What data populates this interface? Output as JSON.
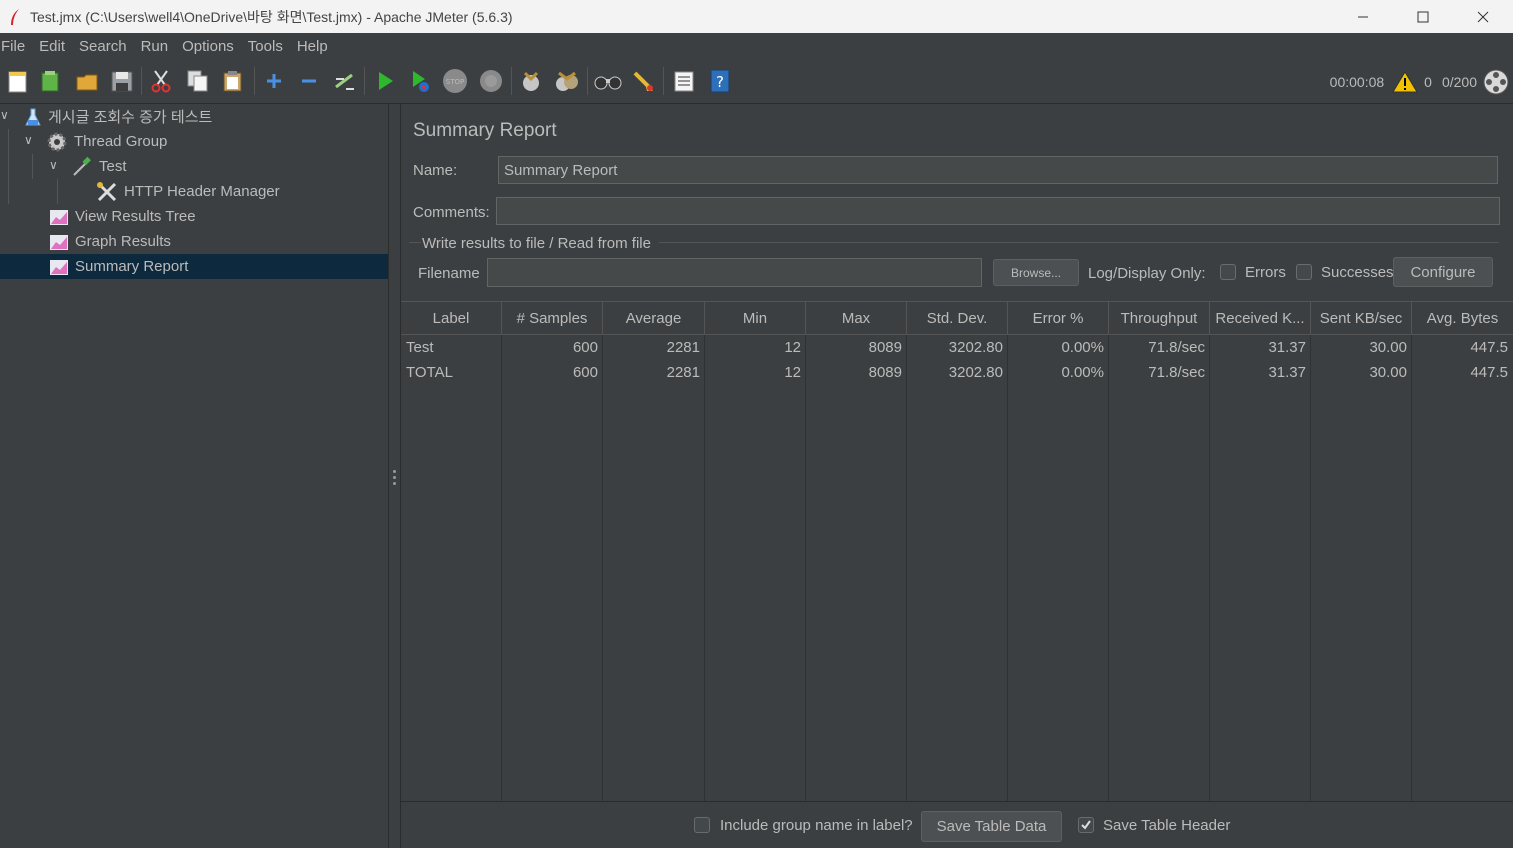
{
  "window": {
    "title": "Test.jmx (C:\\Users\\well4\\OneDrive\\바탕 화면\\Test.jmx) - Apache JMeter (5.6.3)"
  },
  "menu": [
    "File",
    "Edit",
    "Search",
    "Run",
    "Options",
    "Tools",
    "Help"
  ],
  "toolbar": {
    "icons": [
      "new-icon",
      "templates-icon",
      "open-icon",
      "save-icon",
      "cut-icon",
      "copy-icon",
      "paste-icon",
      "expand-icon",
      "collapse-icon",
      "toggle-icon",
      "start-icon",
      "start-no-pause-icon",
      "stop-icon",
      "shutdown-icon",
      "clear-icon",
      "clear-all-icon",
      "search-icon",
      "reset-search-icon",
      "function-helper-icon",
      "help-icon"
    ]
  },
  "status": {
    "elapsed": "00:00:08",
    "warnings": "0",
    "threads": "0/200"
  },
  "tree": {
    "nodes": [
      {
        "label": "게시글 조회수 증가 테스트",
        "icon": "test-plan-icon"
      },
      {
        "label": "Thread Group",
        "icon": "gear-icon"
      },
      {
        "label": "Test",
        "icon": "sampler-icon"
      },
      {
        "label": "HTTP Header Manager",
        "icon": "tools-icon"
      },
      {
        "label": "View Results Tree",
        "icon": "listener-icon"
      },
      {
        "label": "Graph Results",
        "icon": "listener-icon"
      },
      {
        "label": "Summary Report",
        "icon": "listener-icon"
      }
    ]
  },
  "panel": {
    "title": "Summary Report",
    "name_label": "Name:",
    "name_value": "Summary Report",
    "comments_label": "Comments:",
    "comments_value": "",
    "group_title": "Write results to file / Read from file",
    "filename_label": "Filename",
    "filename_value": "",
    "browse_label": "Browse...",
    "log_display_label": "Log/Display Only:",
    "errors_label": "Errors",
    "successes_label": "Successes",
    "configure_label": "Configure"
  },
  "table": {
    "columns": [
      "Label",
      "# Samples",
      "Average",
      "Min",
      "Max",
      "Std. Dev.",
      "Error %",
      "Throughput",
      "Received K...",
      "Sent KB/sec",
      "Avg. Bytes"
    ],
    "rows": [
      [
        "Test",
        "600",
        "2281",
        "12",
        "8089",
        "3202.80",
        "0.00%",
        "71.8/sec",
        "31.37",
        "30.00",
        "447.5"
      ],
      [
        "TOTAL",
        "600",
        "2281",
        "12",
        "8089",
        "3202.80",
        "0.00%",
        "71.8/sec",
        "31.37",
        "30.00",
        "447.5"
      ]
    ]
  },
  "footer": {
    "include_group_label": "Include group name in label?",
    "include_group_checked": false,
    "save_table_data_label": "Save Table Data",
    "save_table_header_label": "Save Table Header",
    "save_table_header_checked": true
  }
}
